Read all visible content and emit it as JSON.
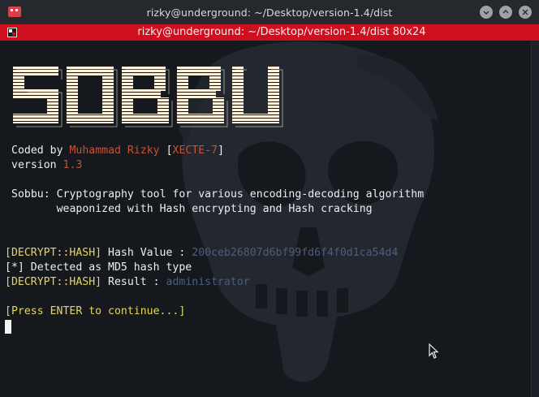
{
  "window": {
    "title": "rizky@underground: ~/Desktop/version-1.4/dist",
    "app_icon": "terminal-app-icon",
    "controls": [
      "minimize-icon",
      "maximize-icon",
      "close-icon"
    ]
  },
  "tab": {
    "title": "rizky@underground: ~/Desktop/version-1.4/dist 80x24",
    "color": "#cf0f1d"
  },
  "terminal": {
    "banner_text": "SOBBU",
    "coded_by_prefix": "Coded by ",
    "author": "Muhammad Rizky",
    "team_open": "[",
    "team": "XECTE-7",
    "team_close": "]",
    "version_label": "version ",
    "version_number": "1.3",
    "description_line1": "Sobbu: Cryptography tool for various encoding-decoding algorithm",
    "description_line2": "       weaponized with Hash encrypting and Hash cracking",
    "hash_prefix": "[DECRYPT::HASH]",
    "hash_label": " Hash Value : ",
    "hash_value": "200ceb26807d6bf99fd6f4f0d1ca54d4",
    "detected_line": "[*] Detected as MD5 hash type",
    "result_prefix": "[DECRYPT::HASH]",
    "result_label": " Result : ",
    "result_value": "administrator",
    "prompt": "[Press ENTER to continue...]"
  },
  "colors": {
    "accent_red": "#c65432",
    "prompt_yellow": "#e5d560",
    "value_dim": "#4e5f7a"
  }
}
